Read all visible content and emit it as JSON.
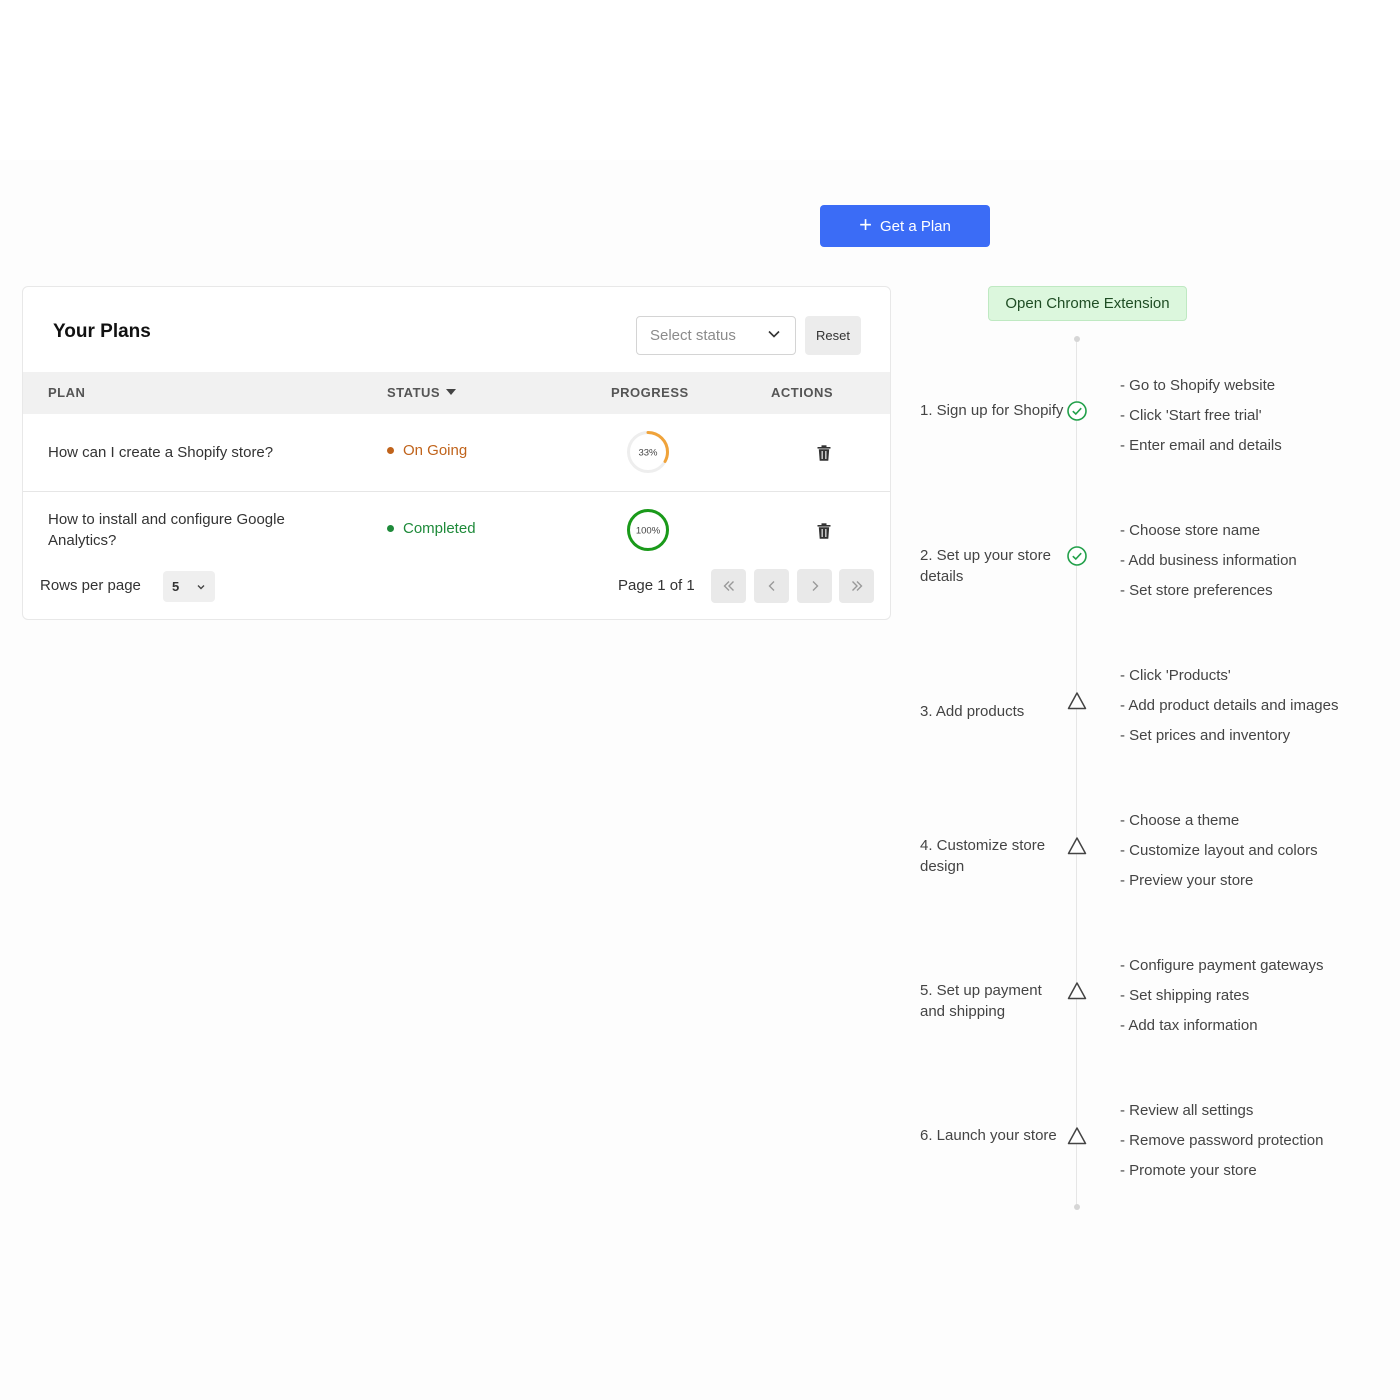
{
  "toolbar": {
    "get_plan_label": "Get a Plan",
    "plus_icon": "+"
  },
  "plans": {
    "title": "Your Plans",
    "status_select_placeholder": "Select status",
    "reset_label": "Reset",
    "columns": {
      "plan": "PLAN",
      "status": "STATUS",
      "progress": "PROGRESS",
      "actions": "ACTIONS"
    },
    "rows": [
      {
        "plan": "How can I create a Shopify store?",
        "status": "On Going",
        "status_color": "#c0631b",
        "dot_color": "#c0631b",
        "progress": 33,
        "progress_label": "33%",
        "ring_color": "#f0a33a"
      },
      {
        "plan": "How to install and configure Google Analytics?",
        "status": "Completed",
        "status_color": "#1e8a3a",
        "dot_color": "#1e8a3a",
        "progress": 100,
        "progress_label": "100%",
        "ring_color": "#1a9a1a"
      }
    ],
    "rows_per_page_label": "Rows per page",
    "rows_per_page_value": "5",
    "page_info": "Page 1 of 1"
  },
  "extension": {
    "label": "Open Chrome Extension"
  },
  "steps": [
    {
      "title": "1. Sign up for Shopify",
      "state": "done",
      "subs": [
        "- Go to Shopify website",
        "- Click 'Start free trial'",
        "- Enter email and details"
      ]
    },
    {
      "title": "2. Set up your store details",
      "state": "done",
      "subs": [
        "- Choose store name",
        "- Add business information",
        "- Set store preferences"
      ]
    },
    {
      "title": "3. Add products",
      "state": "pending",
      "subs": [
        "- Click 'Products'",
        "- Add product details and images",
        "- Set prices and inventory"
      ]
    },
    {
      "title": "4. Customize store design",
      "state": "pending",
      "subs": [
        "- Choose a theme",
        "- Customize layout and colors",
        "- Preview your store"
      ]
    },
    {
      "title": "5. Set up payment and shipping",
      "state": "pending",
      "subs": [
        "- Configure payment gateways",
        "- Set shipping rates",
        "- Add tax information"
      ]
    },
    {
      "title": "6. Launch your store",
      "state": "pending",
      "subs": [
        "- Review all settings",
        "- Remove password protection",
        "- Promote your store"
      ]
    }
  ],
  "colors": {
    "primary": "#3b6cf6",
    "success": "#1e8a3a",
    "warning": "#c0631b"
  }
}
